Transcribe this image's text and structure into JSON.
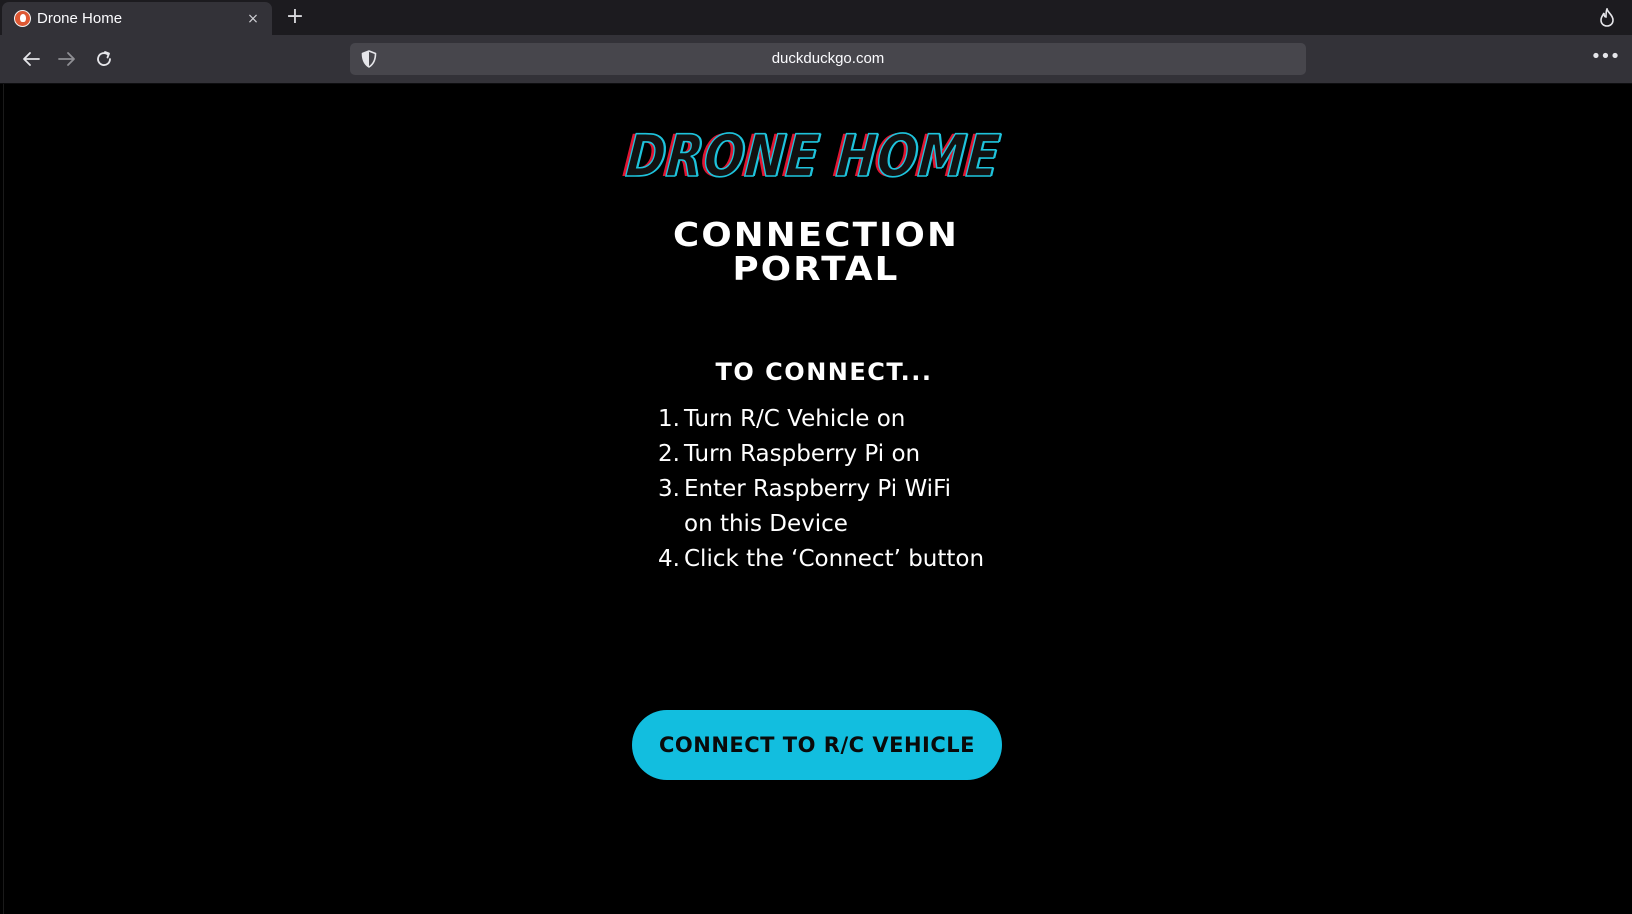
{
  "browser": {
    "tab": {
      "title": "Drone Home",
      "close_label": "×"
    },
    "new_tab_label": "+",
    "address_bar": {
      "url": "duckduckgo.com"
    },
    "menu_label": "•••"
  },
  "page": {
    "logo_text": "DRONE HOME",
    "subtitle_line1": "CONNECTION",
    "subtitle_line2": "PORTAL",
    "instructions_heading": "TO CONNECT...",
    "steps": [
      {
        "num": "1.",
        "text": "Turn R/C Vehicle on"
      },
      {
        "num": "2.",
        "text": "Turn Raspberry Pi on"
      },
      {
        "num": "3.",
        "text": "Enter Raspberry Pi WiFi"
      },
      {
        "num": "",
        "text": "on this Device"
      },
      {
        "num": "4.",
        "text": "Click the ‘Connect’ button"
      }
    ],
    "connect_button_label": "CONNECT TO R/C VEHICLE"
  },
  "colors": {
    "accent": "#12bedf",
    "logo_cyan": "#1ec3dc",
    "logo_red": "#e01633",
    "background": "#000000"
  },
  "icons": [
    "duckduckgo-favicon",
    "close-icon",
    "plus-icon",
    "fire-icon",
    "back-arrow-icon",
    "forward-arrow-icon",
    "reload-icon",
    "shield-icon",
    "more-menu-icon"
  ]
}
